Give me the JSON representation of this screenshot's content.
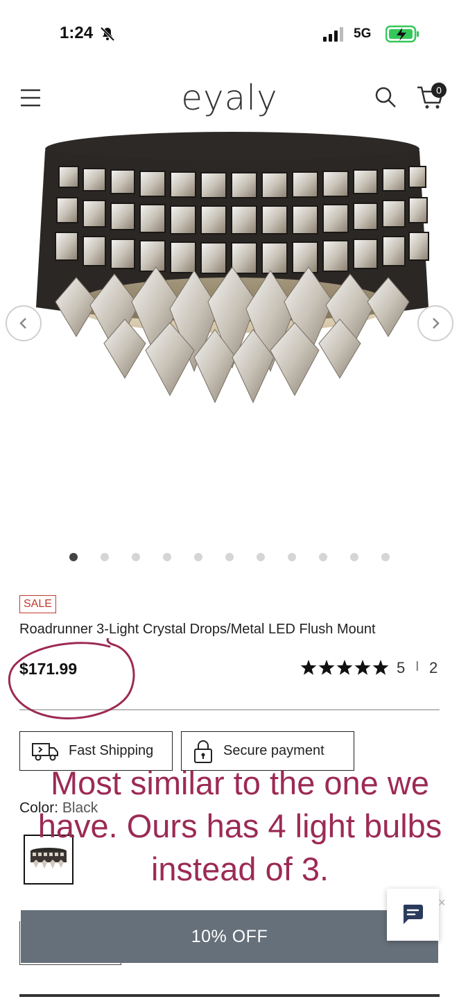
{
  "status_bar": {
    "time": "1:24",
    "network": "5G"
  },
  "header": {
    "logo": "eyaly",
    "cart_count": "0"
  },
  "gallery": {
    "dot_count": 11,
    "active_index": 0
  },
  "product": {
    "sale_label": "SALE",
    "title": "Roadrunner 3-Light Crystal Drops/Metal LED Flush Mount",
    "price": "$171.99",
    "rating": {
      "stars": 5,
      "value": "5",
      "separator": "I",
      "count": "2"
    }
  },
  "badges": {
    "shipping": "Fast Shipping",
    "secure": "Secure payment"
  },
  "color": {
    "label": "Color:",
    "value": "Black"
  },
  "promo": {
    "label": "10% OFF"
  },
  "chat": {
    "close": "×"
  },
  "annotation": {
    "note": "Most similar to the one we have. Ours has 4 light bulbs instead of 3."
  },
  "colors": {
    "accent_annotation": "#9c2a55",
    "sale_red": "#c0392b",
    "promo_bar": "#66707a"
  }
}
